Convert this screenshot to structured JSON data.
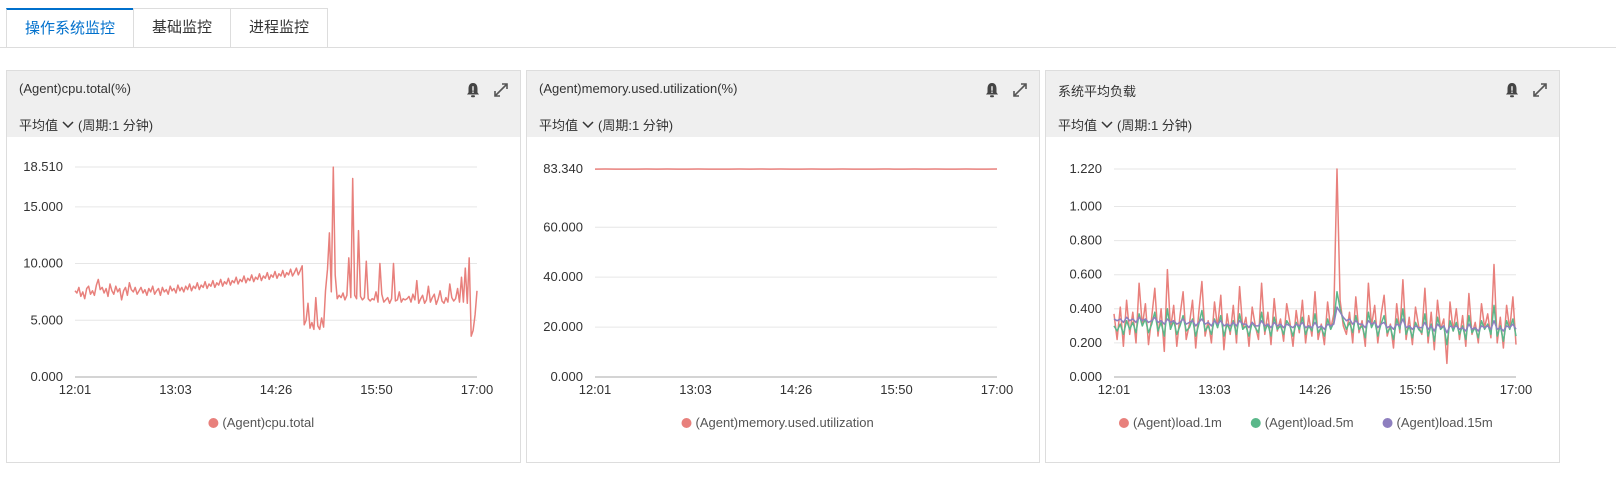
{
  "tabs": [
    {
      "label": "操作系统监控",
      "active": true
    },
    {
      "label": "基础监控",
      "active": false
    },
    {
      "label": "进程监控",
      "active": false
    }
  ],
  "panels": [
    {
      "title": "(Agent)cpu.total(%)",
      "aggregation": "平均值",
      "period": "(周期:1 分钟)",
      "icons": [
        "alarm-bell-icon",
        "fullscreen-icon"
      ]
    },
    {
      "title": "(Agent)memory.used.utilization(%)",
      "aggregation": "平均值",
      "period": "(周期:1 分钟)",
      "icons": [
        "alarm-bell-icon",
        "fullscreen-icon"
      ]
    },
    {
      "title": "系统平均负载",
      "aggregation": "平均值",
      "period": "(周期:1 分钟)",
      "icons": [
        "alarm-bell-icon",
        "fullscreen-icon"
      ]
    }
  ],
  "chart_data": [
    {
      "type": "line",
      "x_ticks": [
        "12:01",
        "13:03",
        "14:26",
        "15:50",
        "17:00"
      ],
      "y_ticks": [
        "0.000",
        "5.000",
        "10.000",
        "15.000",
        "18.510"
      ],
      "ylim": [
        0,
        18.51
      ],
      "xlim": [
        "12:01",
        "17:00"
      ],
      "grid": true,
      "legend_position": "bottom",
      "series": [
        {
          "name": "(Agent)cpu.total",
          "color": "#e8807c",
          "values": [
            7.6,
            7.4,
            7.9,
            7.1,
            7.5,
            6.9,
            7.8,
            8.0,
            7.3,
            7.6,
            7.2,
            8.1,
            8.6,
            7.7,
            7.9,
            7.4,
            7.8,
            7.1,
            8.2,
            7.6,
            7.3,
            8.0,
            7.5,
            7.8,
            6.8,
            7.6,
            7.9,
            7.2,
            8.3,
            7.7,
            7.5,
            7.9,
            7.3,
            7.6,
            7.9,
            7.4,
            7.7,
            7.2,
            7.8,
            7.5,
            8.0,
            7.3,
            7.6,
            7.8,
            7.2,
            7.9,
            7.5,
            7.7,
            7.3,
            8.0,
            7.6,
            7.8,
            7.4,
            8.1,
            7.6,
            7.9,
            7.5,
            8.0,
            7.7,
            8.2,
            7.6,
            8.0,
            7.8,
            8.3,
            7.7,
            8.1,
            7.9,
            8.4,
            7.8,
            8.2,
            8.0,
            8.5,
            7.9,
            8.3,
            8.1,
            8.6,
            8.0,
            8.4,
            8.2,
            8.7,
            8.1,
            8.5,
            8.3,
            8.8,
            8.2,
            8.6,
            8.4,
            8.9,
            8.3,
            8.7,
            8.5,
            9.0,
            8.4,
            8.8,
            8.6,
            9.1,
            8.5,
            8.9,
            8.7,
            9.2,
            8.6,
            9.0,
            8.8,
            9.3,
            8.7,
            9.1,
            8.9,
            9.4,
            8.8,
            9.2,
            9.0,
            9.5,
            8.9,
            9.2,
            9.6,
            9.0,
            9.4,
            9.8,
            4.6,
            5.0,
            6.5,
            4.3,
            4.8,
            4.2,
            7.0,
            4.5,
            4.2,
            5.2,
            4.4,
            7.6,
            9.5,
            12.7,
            7.5,
            18.5,
            9.0,
            6.9,
            7.2,
            7.0,
            7.4,
            6.8,
            7.2,
            10.5,
            7.0,
            17.5,
            7.2,
            6.9,
            12.9,
            7.1,
            6.8,
            7.0,
            10.2,
            6.9,
            6.7,
            6.9,
            6.8,
            7.5,
            6.6,
            10.0,
            7.3,
            6.6,
            6.8,
            7.0,
            6.5,
            6.9,
            10.0,
            6.7,
            6.8,
            7.5,
            6.6,
            6.9,
            6.8,
            6.9,
            7.1,
            6.6,
            7.3,
            6.8,
            8.5,
            6.5,
            6.9,
            7.2,
            6.5,
            6.8,
            8.0,
            6.6,
            7.0,
            7.3,
            6.4,
            6.9,
            7.6,
            6.7,
            6.5,
            7.0,
            6.6,
            8.2,
            7.0,
            6.7,
            6.9,
            7.8,
            6.6,
            8.8,
            6.6,
            9.6,
            6.5,
            10.5,
            3.6,
            4.1,
            5.5,
            7.6
          ]
        }
      ]
    },
    {
      "type": "line",
      "x_ticks": [
        "12:01",
        "13:03",
        "14:26",
        "15:50",
        "17:00"
      ],
      "y_ticks": [
        "0.000",
        "20.000",
        "40.000",
        "60.000",
        "83.340"
      ],
      "ylim": [
        0,
        83.34
      ],
      "xlim": [
        "12:01",
        "17:00"
      ],
      "grid": true,
      "legend_position": "bottom",
      "series": [
        {
          "name": "(Agent)memory.used.utilization",
          "color": "#e8807c",
          "values": [
            83.3,
            83.32,
            83.3,
            83.31,
            83.29,
            83.33,
            83.3,
            83.32,
            83.31,
            83.3,
            83.33,
            83.29,
            83.31,
            83.3,
            83.32,
            83.31,
            83.34,
            83.3,
            83.32,
            83.3,
            83.31,
            83.33,
            83.3,
            83.31,
            83.32,
            83.3,
            83.31,
            83.29,
            83.32,
            83.3,
            83.31,
            83.33,
            83.3,
            83.32,
            83.31,
            83.3,
            83.33,
            83.3,
            83.31,
            83.32
          ]
        }
      ]
    },
    {
      "type": "line",
      "x_ticks": [
        "12:01",
        "13:03",
        "14:26",
        "15:50",
        "17:00"
      ],
      "y_ticks": [
        "0.000",
        "0.200",
        "0.400",
        "0.600",
        "0.800",
        "1.000",
        "1.220"
      ],
      "ylim": [
        0,
        1.22
      ],
      "xlim": [
        "12:01",
        "17:00"
      ],
      "grid": true,
      "legend_position": "bottom",
      "series": [
        {
          "name": "(Agent)load.1m",
          "color": "#e8807c",
          "values": [
            0.37,
            0.22,
            0.41,
            0.18,
            0.45,
            0.25,
            0.38,
            0.2,
            0.55,
            0.3,
            0.43,
            0.19,
            0.35,
            0.52,
            0.24,
            0.4,
            0.15,
            0.63,
            0.28,
            0.42,
            0.18,
            0.36,
            0.5,
            0.22,
            0.31,
            0.45,
            0.17,
            0.38,
            0.56,
            0.24,
            0.33,
            0.2,
            0.44,
            0.29,
            0.48,
            0.16,
            0.37,
            0.25,
            0.42,
            0.2,
            0.53,
            0.28,
            0.35,
            0.18,
            0.41,
            0.3,
            0.22,
            0.55,
            0.25,
            0.38,
            0.19,
            0.46,
            0.27,
            0.34,
            0.21,
            0.43,
            0.32,
            0.18,
            0.39,
            0.26,
            0.45,
            0.2,
            0.36,
            0.24,
            0.5,
            0.22,
            0.31,
            0.19,
            0.44,
            0.28,
            0.37,
            1.22,
            0.45,
            0.3,
            0.25,
            0.38,
            0.2,
            0.47,
            0.26,
            0.33,
            0.18,
            0.55,
            0.3,
            0.42,
            0.2,
            0.36,
            0.48,
            0.24,
            0.31,
            0.17,
            0.43,
            0.26,
            0.57,
            0.22,
            0.35,
            0.19,
            0.41,
            0.3,
            0.25,
            0.52,
            0.2,
            0.38,
            0.16,
            0.45,
            0.28,
            0.34,
            0.08,
            0.44,
            0.27,
            0.4,
            0.22,
            0.36,
            0.18,
            0.49,
            0.25,
            0.32,
            0.2,
            0.43,
            0.29,
            0.37,
            0.23,
            0.66,
            0.2,
            0.35,
            0.17,
            0.42,
            0.28,
            0.47,
            0.19
          ]
        },
        {
          "name": "(Agent)load.5m",
          "color": "#5ab88a",
          "values": [
            0.3,
            0.27,
            0.31,
            0.25,
            0.33,
            0.28,
            0.32,
            0.26,
            0.37,
            0.3,
            0.34,
            0.26,
            0.31,
            0.38,
            0.27,
            0.32,
            0.24,
            0.4,
            0.28,
            0.33,
            0.25,
            0.3,
            0.36,
            0.27,
            0.29,
            0.34,
            0.24,
            0.31,
            0.39,
            0.27,
            0.3,
            0.25,
            0.34,
            0.29,
            0.36,
            0.24,
            0.31,
            0.27,
            0.33,
            0.25,
            0.37,
            0.28,
            0.3,
            0.24,
            0.32,
            0.29,
            0.26,
            0.38,
            0.27,
            0.31,
            0.24,
            0.35,
            0.28,
            0.3,
            0.25,
            0.33,
            0.3,
            0.24,
            0.32,
            0.28,
            0.35,
            0.25,
            0.3,
            0.27,
            0.37,
            0.26,
            0.29,
            0.24,
            0.34,
            0.28,
            0.32,
            0.5,
            0.4,
            0.33,
            0.28,
            0.32,
            0.26,
            0.36,
            0.28,
            0.3,
            0.23,
            0.38,
            0.29,
            0.33,
            0.24,
            0.31,
            0.36,
            0.26,
            0.29,
            0.22,
            0.34,
            0.28,
            0.4,
            0.25,
            0.3,
            0.23,
            0.32,
            0.28,
            0.26,
            0.37,
            0.24,
            0.31,
            0.21,
            0.35,
            0.28,
            0.3,
            0.19,
            0.33,
            0.27,
            0.32,
            0.25,
            0.3,
            0.22,
            0.36,
            0.26,
            0.29,
            0.23,
            0.33,
            0.28,
            0.31,
            0.25,
            0.42,
            0.24,
            0.3,
            0.21,
            0.33,
            0.28,
            0.34,
            0.24
          ]
        },
        {
          "name": "(Agent)load.15m",
          "color": "#8e7fbf",
          "values": [
            0.34,
            0.33,
            0.34,
            0.32,
            0.35,
            0.33,
            0.34,
            0.32,
            0.35,
            0.33,
            0.34,
            0.32,
            0.33,
            0.35,
            0.32,
            0.33,
            0.31,
            0.34,
            0.32,
            0.33,
            0.31,
            0.32,
            0.34,
            0.31,
            0.32,
            0.33,
            0.3,
            0.32,
            0.34,
            0.31,
            0.32,
            0.3,
            0.33,
            0.31,
            0.33,
            0.3,
            0.31,
            0.3,
            0.32,
            0.3,
            0.33,
            0.31,
            0.31,
            0.29,
            0.32,
            0.3,
            0.3,
            0.33,
            0.3,
            0.31,
            0.29,
            0.32,
            0.3,
            0.31,
            0.29,
            0.31,
            0.3,
            0.29,
            0.31,
            0.3,
            0.32,
            0.29,
            0.3,
            0.29,
            0.32,
            0.29,
            0.3,
            0.28,
            0.31,
            0.3,
            0.31,
            0.41,
            0.38,
            0.35,
            0.33,
            0.34,
            0.31,
            0.33,
            0.31,
            0.31,
            0.29,
            0.33,
            0.31,
            0.32,
            0.29,
            0.31,
            0.32,
            0.29,
            0.3,
            0.28,
            0.31,
            0.3,
            0.34,
            0.29,
            0.3,
            0.28,
            0.3,
            0.29,
            0.29,
            0.32,
            0.28,
            0.3,
            0.27,
            0.31,
            0.29,
            0.3,
            0.26,
            0.3,
            0.29,
            0.3,
            0.28,
            0.29,
            0.27,
            0.31,
            0.28,
            0.29,
            0.27,
            0.3,
            0.29,
            0.3,
            0.28,
            0.33,
            0.28,
            0.29,
            0.27,
            0.3,
            0.29,
            0.31,
            0.28
          ]
        }
      ]
    }
  ]
}
